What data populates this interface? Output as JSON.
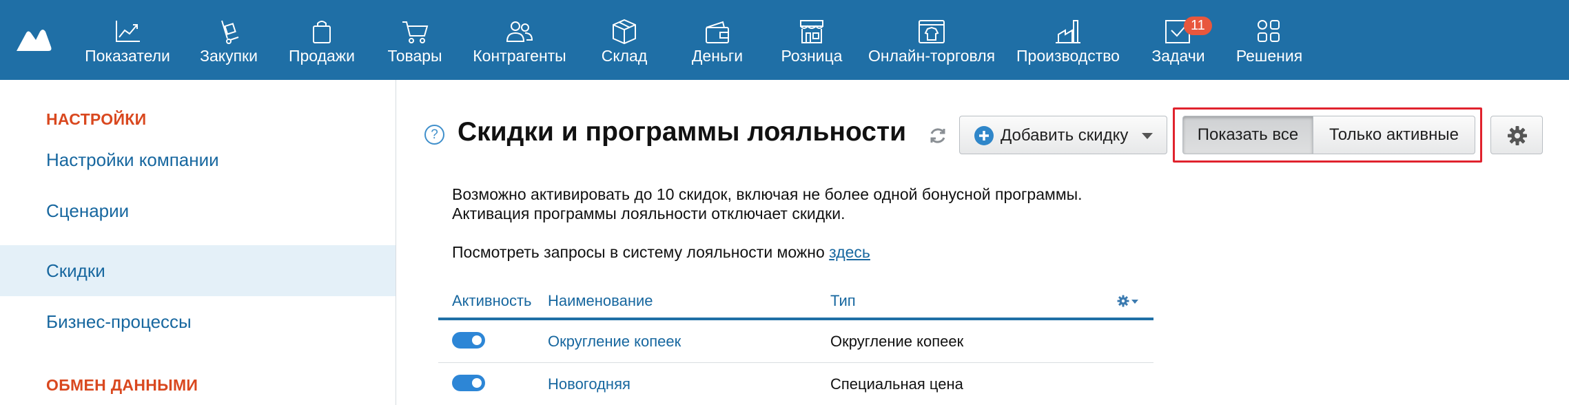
{
  "nav": {
    "items": [
      {
        "label": "Показатели",
        "icon": "chart-line-icon"
      },
      {
        "label": "Закупки",
        "icon": "hand-truck-icon"
      },
      {
        "label": "Продажи",
        "icon": "shopping-bag-icon"
      },
      {
        "label": "Товары",
        "icon": "cart-icon"
      },
      {
        "label": "Контрагенты",
        "icon": "users-icon"
      },
      {
        "label": "Склад",
        "icon": "box-icon"
      },
      {
        "label": "Деньги",
        "icon": "wallet-icon"
      },
      {
        "label": "Розница",
        "icon": "store-icon"
      },
      {
        "label": "Онлайн-торговля",
        "icon": "online-store-icon"
      },
      {
        "label": "Производство",
        "icon": "factory-icon"
      },
      {
        "label": "Задачи",
        "icon": "task-check-icon",
        "badge": "11"
      },
      {
        "label": "Решения",
        "icon": "apps-grid-icon"
      }
    ]
  },
  "sidebar": {
    "section1": "НАСТРОЙКИ",
    "items": [
      {
        "label": "Настройки компании"
      },
      {
        "label": "Сценарии"
      },
      {
        "label": "Скидки",
        "active": true
      },
      {
        "label": "Бизнес-процессы"
      }
    ],
    "section2": "ОБМЕН ДАННЫМИ"
  },
  "header": {
    "help": "?",
    "title": "Скидки и программы лояльности",
    "add_button": "Добавить скидку",
    "show_all": "Показать все",
    "only_active": "Только активные"
  },
  "info": {
    "line1": "Возможно активировать до 10 скидок, включая не более одной бонусной программы.",
    "line2": "Активация программы лояльности отключает скидки.",
    "line3_text": "Посмотреть запросы в систему лояльности можно",
    "line3_link": "здесь"
  },
  "table": {
    "columns": [
      "Активность",
      "Наименование",
      "Тип"
    ],
    "rows": [
      {
        "active": true,
        "name": "Округление копеек",
        "type": "Округление копеек"
      },
      {
        "active": true,
        "name": "Новогодняя",
        "type": "Специальная цена"
      }
    ]
  },
  "colors": {
    "nav_bg": "#1f6fa6",
    "accent_red": "#d9481f",
    "link_blue": "#17679f",
    "badge": "#e8573d",
    "highlight": "#e0222d"
  }
}
